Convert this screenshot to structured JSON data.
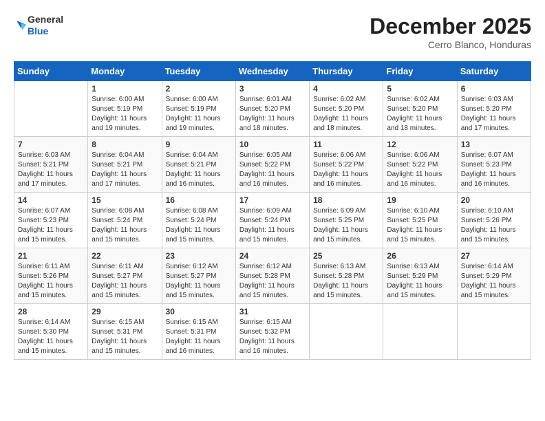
{
  "header": {
    "logo_general": "General",
    "logo_blue": "Blue",
    "month_title": "December 2025",
    "subtitle": "Cerro Blanco, Honduras"
  },
  "calendar": {
    "days_of_week": [
      "Sunday",
      "Monday",
      "Tuesday",
      "Wednesday",
      "Thursday",
      "Friday",
      "Saturday"
    ],
    "weeks": [
      [
        {
          "day": "",
          "info": ""
        },
        {
          "day": "1",
          "info": "Sunrise: 6:00 AM\nSunset: 5:19 PM\nDaylight: 11 hours\nand 19 minutes."
        },
        {
          "day": "2",
          "info": "Sunrise: 6:00 AM\nSunset: 5:19 PM\nDaylight: 11 hours\nand 19 minutes."
        },
        {
          "day": "3",
          "info": "Sunrise: 6:01 AM\nSunset: 5:20 PM\nDaylight: 11 hours\nand 18 minutes."
        },
        {
          "day": "4",
          "info": "Sunrise: 6:02 AM\nSunset: 5:20 PM\nDaylight: 11 hours\nand 18 minutes."
        },
        {
          "day": "5",
          "info": "Sunrise: 6:02 AM\nSunset: 5:20 PM\nDaylight: 11 hours\nand 18 minutes."
        },
        {
          "day": "6",
          "info": "Sunrise: 6:03 AM\nSunset: 5:20 PM\nDaylight: 11 hours\nand 17 minutes."
        }
      ],
      [
        {
          "day": "7",
          "info": "Sunrise: 6:03 AM\nSunset: 5:21 PM\nDaylight: 11 hours\nand 17 minutes."
        },
        {
          "day": "8",
          "info": "Sunrise: 6:04 AM\nSunset: 5:21 PM\nDaylight: 11 hours\nand 17 minutes."
        },
        {
          "day": "9",
          "info": "Sunrise: 6:04 AM\nSunset: 5:21 PM\nDaylight: 11 hours\nand 16 minutes."
        },
        {
          "day": "10",
          "info": "Sunrise: 6:05 AM\nSunset: 5:22 PM\nDaylight: 11 hours\nand 16 minutes."
        },
        {
          "day": "11",
          "info": "Sunrise: 6:06 AM\nSunset: 5:22 PM\nDaylight: 11 hours\nand 16 minutes."
        },
        {
          "day": "12",
          "info": "Sunrise: 6:06 AM\nSunset: 5:22 PM\nDaylight: 11 hours\nand 16 minutes."
        },
        {
          "day": "13",
          "info": "Sunrise: 6:07 AM\nSunset: 5:23 PM\nDaylight: 11 hours\nand 16 minutes."
        }
      ],
      [
        {
          "day": "14",
          "info": "Sunrise: 6:07 AM\nSunset: 5:23 PM\nDaylight: 11 hours\nand 15 minutes."
        },
        {
          "day": "15",
          "info": "Sunrise: 6:08 AM\nSunset: 5:24 PM\nDaylight: 11 hours\nand 15 minutes."
        },
        {
          "day": "16",
          "info": "Sunrise: 6:08 AM\nSunset: 5:24 PM\nDaylight: 11 hours\nand 15 minutes."
        },
        {
          "day": "17",
          "info": "Sunrise: 6:09 AM\nSunset: 5:24 PM\nDaylight: 11 hours\nand 15 minutes."
        },
        {
          "day": "18",
          "info": "Sunrise: 6:09 AM\nSunset: 5:25 PM\nDaylight: 11 hours\nand 15 minutes."
        },
        {
          "day": "19",
          "info": "Sunrise: 6:10 AM\nSunset: 5:25 PM\nDaylight: 11 hours\nand 15 minutes."
        },
        {
          "day": "20",
          "info": "Sunrise: 6:10 AM\nSunset: 5:26 PM\nDaylight: 11 hours\nand 15 minutes."
        }
      ],
      [
        {
          "day": "21",
          "info": "Sunrise: 6:11 AM\nSunset: 5:26 PM\nDaylight: 11 hours\nand 15 minutes."
        },
        {
          "day": "22",
          "info": "Sunrise: 6:11 AM\nSunset: 5:27 PM\nDaylight: 11 hours\nand 15 minutes."
        },
        {
          "day": "23",
          "info": "Sunrise: 6:12 AM\nSunset: 5:27 PM\nDaylight: 11 hours\nand 15 minutes."
        },
        {
          "day": "24",
          "info": "Sunrise: 6:12 AM\nSunset: 5:28 PM\nDaylight: 11 hours\nand 15 minutes."
        },
        {
          "day": "25",
          "info": "Sunrise: 6:13 AM\nSunset: 5:28 PM\nDaylight: 11 hours\nand 15 minutes."
        },
        {
          "day": "26",
          "info": "Sunrise: 6:13 AM\nSunset: 5:29 PM\nDaylight: 11 hours\nand 15 minutes."
        },
        {
          "day": "27",
          "info": "Sunrise: 6:14 AM\nSunset: 5:29 PM\nDaylight: 11 hours\nand 15 minutes."
        }
      ],
      [
        {
          "day": "28",
          "info": "Sunrise: 6:14 AM\nSunset: 5:30 PM\nDaylight: 11 hours\nand 15 minutes."
        },
        {
          "day": "29",
          "info": "Sunrise: 6:15 AM\nSunset: 5:31 PM\nDaylight: 11 hours\nand 15 minutes."
        },
        {
          "day": "30",
          "info": "Sunrise: 6:15 AM\nSunset: 5:31 PM\nDaylight: 11 hours\nand 16 minutes."
        },
        {
          "day": "31",
          "info": "Sunrise: 6:15 AM\nSunset: 5:32 PM\nDaylight: 11 hours\nand 16 minutes."
        },
        {
          "day": "",
          "info": ""
        },
        {
          "day": "",
          "info": ""
        },
        {
          "day": "",
          "info": ""
        }
      ]
    ]
  }
}
